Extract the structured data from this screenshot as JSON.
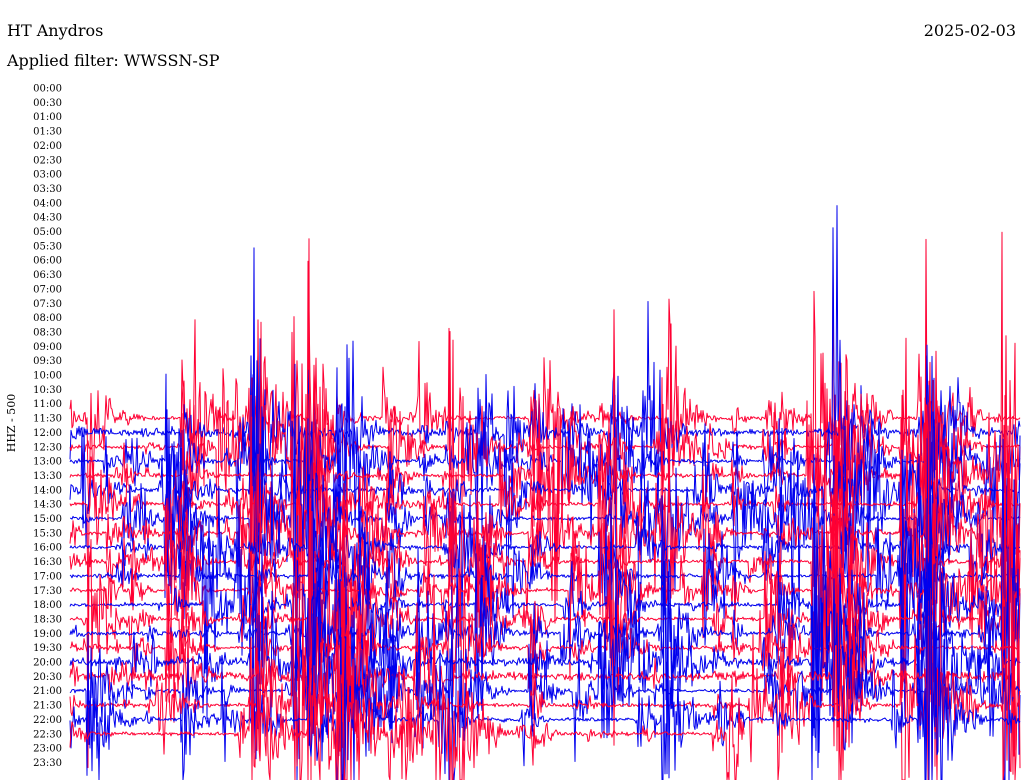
{
  "header": {
    "station": "HT Anydros",
    "date": "2025-02-03",
    "filter_label": "Applied filter:",
    "filter_value": "WWSSN-SP"
  },
  "channel_label": "HHZ - 500",
  "colors": {
    "trace_a": "#0000ee",
    "trace_b": "#ff0033",
    "background": "#ffffff",
    "text": "#000000"
  },
  "chart_data": {
    "type": "line",
    "title": "",
    "xlabel": "",
    "ylabel": "HHZ - 500",
    "grid": false,
    "legend": "none",
    "x_range_minutes": [
      0,
      30
    ],
    "row_labels": [
      "00:00",
      "00:30",
      "01:00",
      "01:30",
      "02:00",
      "02:30",
      "03:00",
      "03:30",
      "04:00",
      "04:30",
      "05:00",
      "05:30",
      "06:00",
      "06:30",
      "07:00",
      "07:30",
      "08:00",
      "08:30",
      "09:00",
      "09:30",
      "10:00",
      "10:30",
      "11:00",
      "11:30",
      "12:00",
      "12:30",
      "13:00",
      "13:30",
      "14:00",
      "14:30",
      "15:00",
      "15:30",
      "16:00",
      "16:30",
      "17:00",
      "17:30",
      "18:00",
      "18:30",
      "19:00",
      "19:30",
      "20:00",
      "20:30",
      "21:00",
      "21:30",
      "22:00",
      "22:30",
      "23:00",
      "23:30"
    ],
    "rows_with_trace": [
      "11:30",
      "12:00",
      "12:30",
      "13:00",
      "13:30",
      "14:00",
      "14:30",
      "15:00",
      "15:30",
      "16:00",
      "16:30",
      "17:00",
      "17:30",
      "18:00",
      "18:30",
      "19:00",
      "19:30",
      "20:00",
      "20:30",
      "21:00",
      "21:30",
      "22:00",
      "22:30"
    ],
    "trace_colors_alternate": [
      "#0000ee",
      "#ff0033"
    ],
    "last_trace_end_fraction": 0.71
  }
}
